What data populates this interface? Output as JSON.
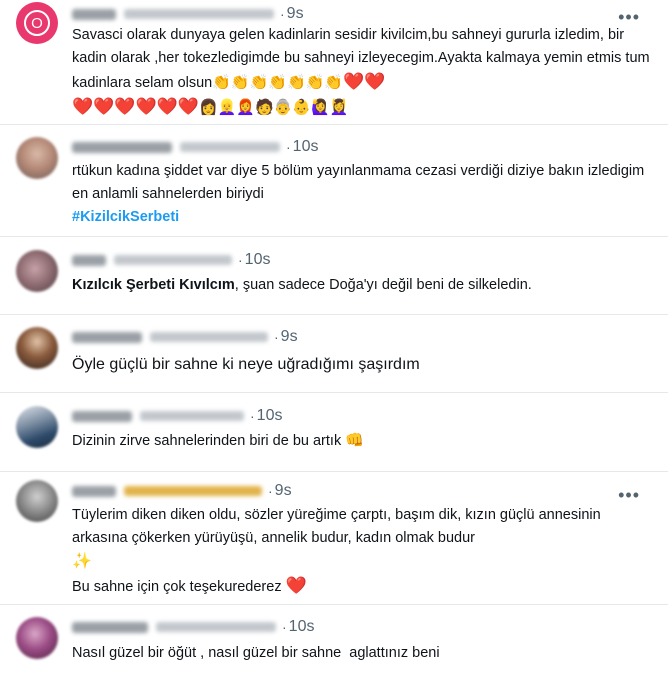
{
  "tweets": [
    {
      "avatar_letter": "O",
      "time": "9s",
      "text": "Savasci olarak dunyaya gelen kadinlarin sesidir kivilcim,bu sahneyi gururla izledim, bir kadin olarak ,her tokezledigimde bu sahneyi izleyecegim.Ayakta kalmaya yemin etmis tum kadinlara selam olsun",
      "emoji_line1": "👏👏👏👏👏👏👏",
      "hearts_inline": "❤️❤️",
      "emoji_line2_hearts": "❤️❤️❤️❤️❤️❤️",
      "emoji_line2_faces": "👩👱‍♀️👩‍🦰🧑👵👶🙋‍♀️💆‍♀️",
      "more_icon": "•••"
    },
    {
      "time": "10s",
      "text": "rtükun kadına şiddet var diye 5 bölüm yayınlanmama cezasi verdiği diziye bakın izledigim en anlamli sahnelerden biriydi",
      "hashtag": "#KizilcikSerbeti"
    },
    {
      "time": "10s",
      "bold": "Kızılcık Şerbeti Kıvılcım",
      "text": ", şuan sadece Doğa'yı değil beni de silkeledin."
    },
    {
      "time": "9s",
      "text": "Öyle güçlü bir sahne ki neye uğradığımı şaşırdım"
    },
    {
      "time": "10s",
      "text": "Dizinin zirve sahnelerinden biri de bu artık",
      "emoji": "👊"
    },
    {
      "time": "9s",
      "text": "Tüylerim diken diken oldu, sözler yüreğime çarptı, başım dik, kızın güçlü annesinin arkasına çökerken yürüyüşü, annelik budur, kadın olmak budur",
      "sparkle": "✨",
      "line2": "Bu sahne için çok teşekurederez",
      "heart": "❤️",
      "more_icon": "•••"
    },
    {
      "time": "10s",
      "text": "Nasıl güzel bir öğüt , nasıl güzel bir sahne  aglattınız beni"
    }
  ]
}
